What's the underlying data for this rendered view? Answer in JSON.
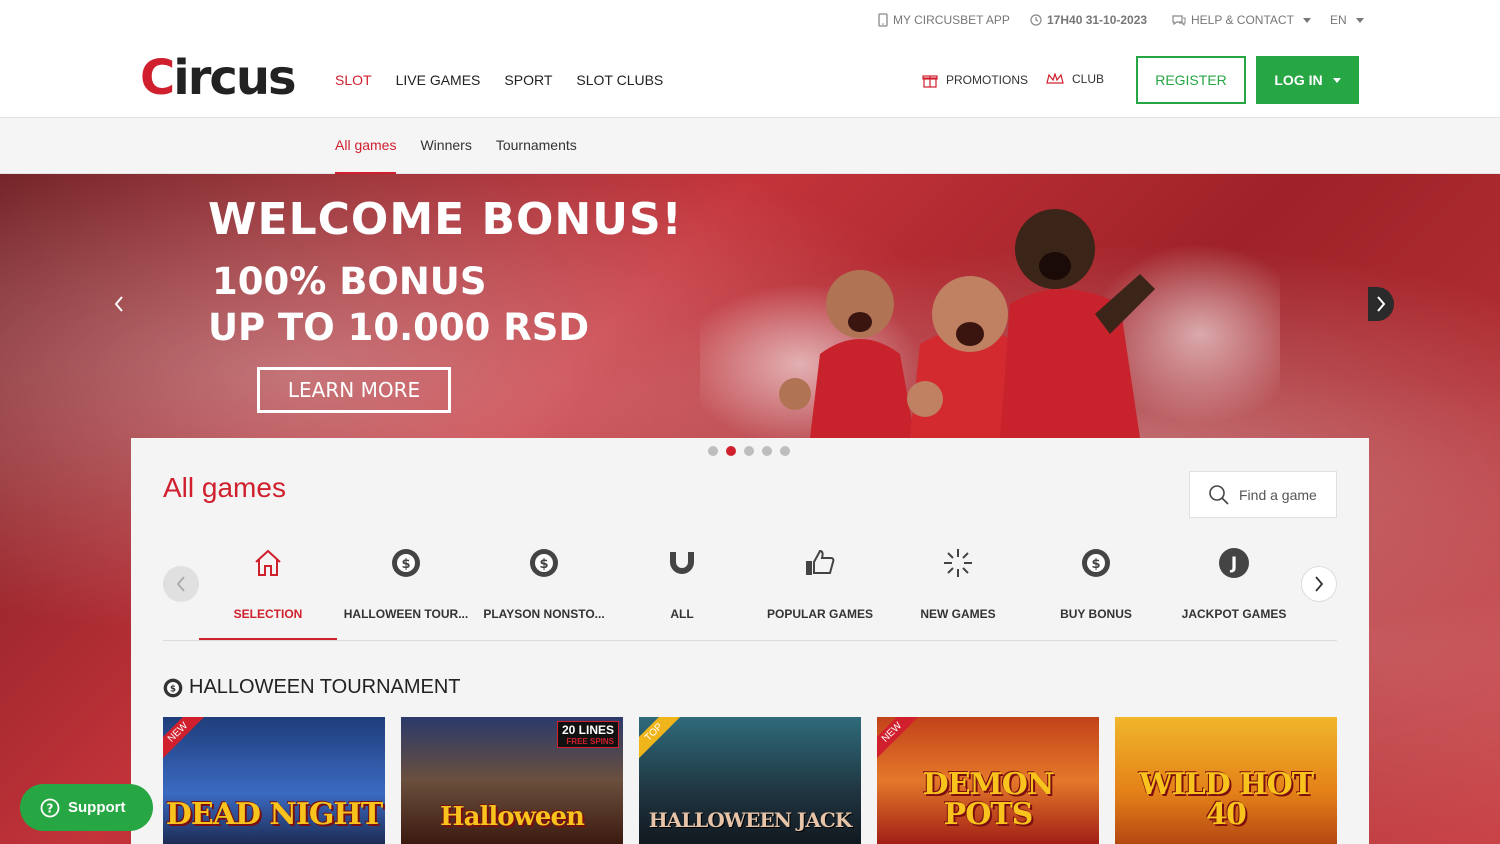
{
  "utility": {
    "app_label": "MY CIRCUSBET APP",
    "datetime": "17H40 31-10-2023",
    "help_label": "HELP & CONTACT",
    "language": "EN"
  },
  "header": {
    "logo_text": "Circus",
    "nav": [
      {
        "label": "SLOT",
        "active": true
      },
      {
        "label": "LIVE GAMES"
      },
      {
        "label": "SPORT"
      },
      {
        "label": "SLOT CLUBS"
      }
    ],
    "promotions_label": "PROMOTIONS",
    "club_label": "CLUB",
    "register_label": "REGISTER",
    "login_label": "LOG IN"
  },
  "subnav": {
    "items": [
      {
        "label": "All games",
        "active": true
      },
      {
        "label": "Winners"
      },
      {
        "label": "Tournaments"
      }
    ]
  },
  "hero": {
    "title": "WELCOME BONUS!",
    "line1": "100% BONUS",
    "line2": "UP TO 10.000 RSD",
    "cta": "LEARN MORE",
    "slides": 5,
    "active_slide": 2
  },
  "games_panel": {
    "title": "All games",
    "search_placeholder": "Find a game",
    "categories": [
      {
        "label": "SELECTION",
        "icon": "home-icon",
        "active": true
      },
      {
        "label": "HALLOWEEN TOUR...",
        "icon": "chip-icon"
      },
      {
        "label": "PLAYSON NONSTO...",
        "icon": "chip-icon"
      },
      {
        "label": "ALL",
        "icon": "magnet-icon"
      },
      {
        "label": "POPULAR GAMES",
        "icon": "thumbs-up-icon"
      },
      {
        "label": "NEW GAMES",
        "icon": "sparkle-icon"
      },
      {
        "label": "BUY BONUS",
        "icon": "chip-icon"
      },
      {
        "label": "JACKPOT GAMES",
        "icon": "jackpot-icon"
      }
    ],
    "section_title": "HALLOWEEN TOURNAMENT",
    "games": [
      {
        "name": "DEAD NIGHT",
        "ribbon": "NEW"
      },
      {
        "name": "Halloween",
        "badge": "20 LINES",
        "badge_sub": "FREE SPINS"
      },
      {
        "name": "HALLOWEEN JACK",
        "ribbon": "TOP"
      },
      {
        "name": "DEMON POTS",
        "ribbon": "NEW"
      },
      {
        "name": "WILD HOT 40"
      }
    ]
  },
  "support": {
    "label": "Support"
  },
  "colors": {
    "brand_red": "#d0202e",
    "green": "#27a644"
  }
}
